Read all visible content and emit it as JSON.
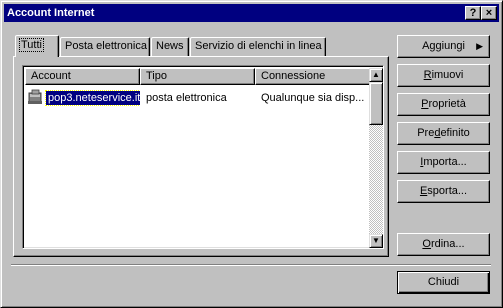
{
  "window": {
    "title": "Account Internet",
    "help_btn": "?",
    "close_btn": "×"
  },
  "tabs": [
    {
      "label": "Tutti",
      "active": true
    },
    {
      "label": "Posta elettronica",
      "active": false
    },
    {
      "label": "News",
      "active": false
    },
    {
      "label": "Servizio di elenchi in linea",
      "active": false
    }
  ],
  "list": {
    "columns": [
      "Account",
      "Tipo",
      "Connessione"
    ],
    "rows": [
      {
        "account": "pop3.neteservice.it",
        "tipo": "posta elettronica",
        "connessione": "Qualunque sia disp...",
        "icon": "mail-server-icon",
        "selected": true
      }
    ]
  },
  "buttons": {
    "aggiungi": {
      "pre": "A",
      "ul": "g",
      "post": "giungi"
    },
    "rimuovi": {
      "pre": "",
      "ul": "R",
      "post": "imuovi"
    },
    "proprieta": {
      "pre": "",
      "ul": "P",
      "post": "roprietà"
    },
    "predefinito": {
      "pre": "Pre",
      "ul": "d",
      "post": "efinito"
    },
    "importa": {
      "pre": "",
      "ul": "I",
      "post": "mporta..."
    },
    "esporta": {
      "pre": "",
      "ul": "E",
      "post": "sporta..."
    },
    "ordina": {
      "pre": "",
      "ul": "O",
      "post": "rdina..."
    },
    "chiudi": "Chiudi"
  },
  "colors": {
    "titlebar": "#000080",
    "face": "#c0c0c0",
    "selection": "#000080"
  }
}
